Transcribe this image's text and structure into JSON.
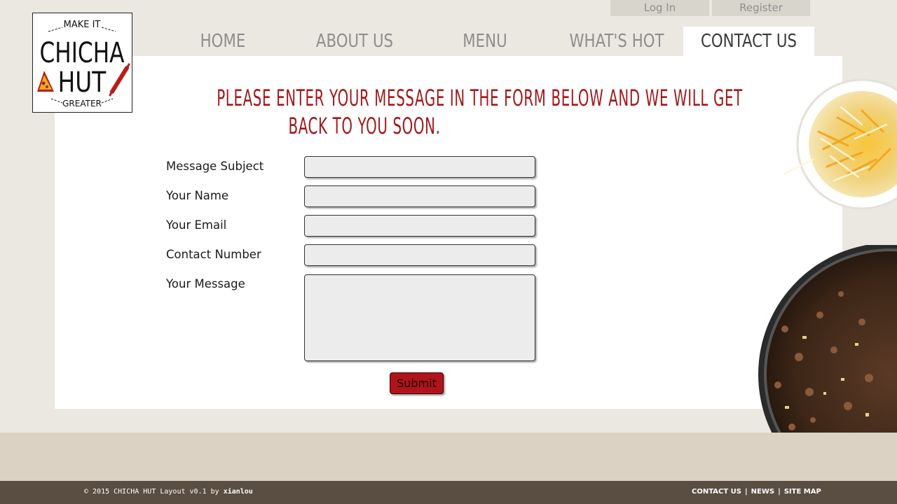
{
  "account": {
    "login_label": "Log In",
    "register_label": "Register"
  },
  "logo": {
    "top_text": "MAKE IT",
    "name_line1": "CHICHA",
    "name_line2": "HUT",
    "bottom_text": "GREATER"
  },
  "nav": {
    "items": [
      {
        "label": "HOME",
        "active": false
      },
      {
        "label": "ABOUT US",
        "active": false
      },
      {
        "label": "MENU",
        "active": false
      },
      {
        "label": "WHAT'S HOT",
        "active": false
      },
      {
        "label": "CONTACT US",
        "active": true
      }
    ]
  },
  "page": {
    "heading_line1": "PLEASE ENTER YOUR MESSAGE IN THE FORM BELOW AND WE WILL GET",
    "heading_line2": "BACK TO YOU SOON."
  },
  "form": {
    "fields": [
      {
        "label": "Message Subject",
        "value": ""
      },
      {
        "label": "Your Name",
        "value": ""
      },
      {
        "label": "Your Email",
        "value": ""
      },
      {
        "label": "Contact Number",
        "value": ""
      },
      {
        "label": "Your Message",
        "value": ""
      }
    ],
    "submit_label": "Submit"
  },
  "footer": {
    "copyright_prefix": "© 2015 CHICHA HUT Layout v0.1 by",
    "author": "xianlou",
    "links": [
      "CONTACT US",
      "NEWS",
      "SITE MAP"
    ],
    "separator": "|"
  },
  "colors": {
    "brand_red": "#a1191c",
    "page_bg": "#ebe7e1",
    "footer_bar": "#5a4d42",
    "footer_band": "#dbd2c4",
    "nav_inactive": "#8e8e8e"
  }
}
